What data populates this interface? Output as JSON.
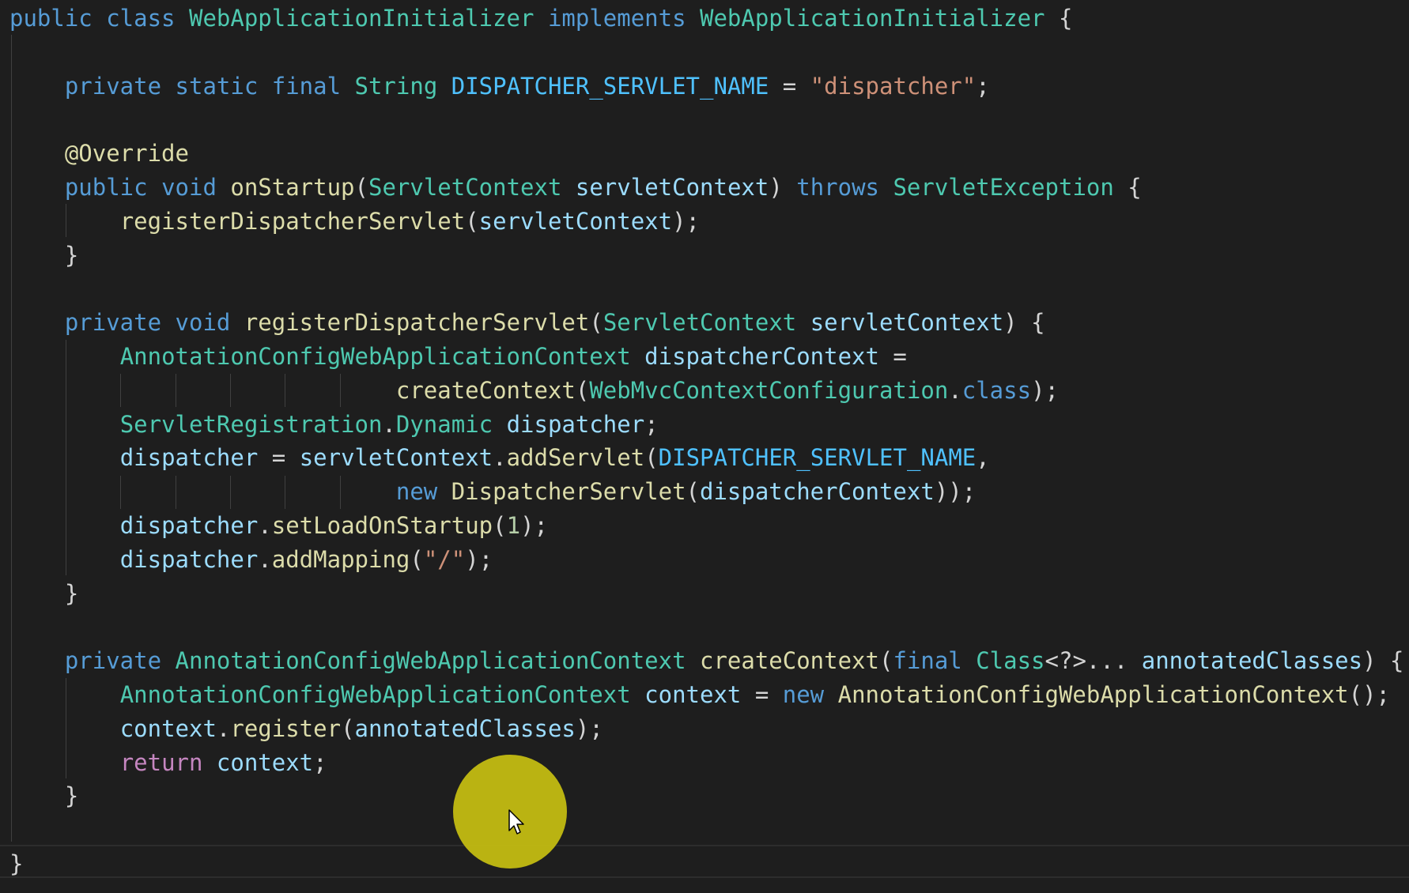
{
  "editor": {
    "language": "java",
    "theme_colors": {
      "background": "#1e1e1e",
      "keyword": "#569cd6",
      "control": "#c586c0",
      "type": "#4ec9b0",
      "function": "#dcdcaa",
      "variable": "#9cdcfe",
      "constant": "#4fc1ff",
      "string": "#ce9178",
      "number": "#b5cea8",
      "text": "#d4d4d4",
      "cursor_highlight": "#c8c011"
    },
    "icons": {
      "mouse_pointer": "mouse-pointer-icon",
      "click_highlight": "cursor-highlight-circle"
    },
    "lines": [
      {
        "tokens": [
          {
            "c": "kw",
            "t": "public "
          },
          {
            "c": "kw",
            "t": "class "
          },
          {
            "c": "type",
            "t": "WebApplicationInitializer "
          },
          {
            "c": "kw",
            "t": "implements "
          },
          {
            "c": "type",
            "t": "WebApplicationInitializer "
          },
          {
            "c": "plain",
            "t": "{"
          }
        ]
      },
      {
        "tokens": []
      },
      {
        "tokens": [
          {
            "c": "plain",
            "t": "    "
          },
          {
            "c": "kw",
            "t": "private "
          },
          {
            "c": "kw",
            "t": "static "
          },
          {
            "c": "kw",
            "t": "final "
          },
          {
            "c": "type",
            "t": "String "
          },
          {
            "c": "cst",
            "t": "DISPATCHER_SERVLET_NAME"
          },
          {
            "c": "plain",
            "t": " = "
          },
          {
            "c": "str",
            "t": "\"dispatcher\""
          },
          {
            "c": "plain",
            "t": ";"
          }
        ]
      },
      {
        "tokens": []
      },
      {
        "tokens": [
          {
            "c": "plain",
            "t": "    "
          },
          {
            "c": "ann",
            "t": "@Override"
          }
        ]
      },
      {
        "tokens": [
          {
            "c": "plain",
            "t": "    "
          },
          {
            "c": "kw",
            "t": "public "
          },
          {
            "c": "kw",
            "t": "void "
          },
          {
            "c": "fn",
            "t": "onStartup"
          },
          {
            "c": "plain",
            "t": "("
          },
          {
            "c": "type",
            "t": "ServletContext "
          },
          {
            "c": "var",
            "t": "servletContext"
          },
          {
            "c": "plain",
            "t": ") "
          },
          {
            "c": "kw",
            "t": "throws "
          },
          {
            "c": "type",
            "t": "ServletException "
          },
          {
            "c": "plain",
            "t": "{"
          }
        ]
      },
      {
        "tokens": [
          {
            "c": "plain",
            "t": "        "
          },
          {
            "c": "fn",
            "t": "registerDispatcherServlet"
          },
          {
            "c": "plain",
            "t": "("
          },
          {
            "c": "var",
            "t": "servletContext"
          },
          {
            "c": "plain",
            "t": ");"
          }
        ]
      },
      {
        "tokens": [
          {
            "c": "plain",
            "t": "    }"
          }
        ]
      },
      {
        "tokens": []
      },
      {
        "tokens": [
          {
            "c": "plain",
            "t": "    "
          },
          {
            "c": "kw",
            "t": "private "
          },
          {
            "c": "kw",
            "t": "void "
          },
          {
            "c": "fn",
            "t": "registerDispatcherServlet"
          },
          {
            "c": "plain",
            "t": "("
          },
          {
            "c": "type",
            "t": "ServletContext "
          },
          {
            "c": "var",
            "t": "servletContext"
          },
          {
            "c": "plain",
            "t": ") {"
          }
        ]
      },
      {
        "tokens": [
          {
            "c": "plain",
            "t": "        "
          },
          {
            "c": "type",
            "t": "AnnotationConfigWebApplicationContext "
          },
          {
            "c": "var",
            "t": "dispatcherContext"
          },
          {
            "c": "plain",
            "t": " ="
          }
        ]
      },
      {
        "tokens": [
          {
            "c": "plain",
            "t": "                            "
          },
          {
            "c": "fn",
            "t": "createContext"
          },
          {
            "c": "plain",
            "t": "("
          },
          {
            "c": "type",
            "t": "WebMvcContextConfiguration"
          },
          {
            "c": "plain",
            "t": "."
          },
          {
            "c": "kw",
            "t": "class"
          },
          {
            "c": "plain",
            "t": ");"
          }
        ]
      },
      {
        "tokens": [
          {
            "c": "plain",
            "t": "        "
          },
          {
            "c": "type",
            "t": "ServletRegistration"
          },
          {
            "c": "plain",
            "t": "."
          },
          {
            "c": "type",
            "t": "Dynamic "
          },
          {
            "c": "var",
            "t": "dispatcher"
          },
          {
            "c": "plain",
            "t": ";"
          }
        ]
      },
      {
        "tokens": [
          {
            "c": "plain",
            "t": "        "
          },
          {
            "c": "var",
            "t": "dispatcher"
          },
          {
            "c": "plain",
            "t": " = "
          },
          {
            "c": "var",
            "t": "servletContext"
          },
          {
            "c": "plain",
            "t": "."
          },
          {
            "c": "fn",
            "t": "addServlet"
          },
          {
            "c": "plain",
            "t": "("
          },
          {
            "c": "cst",
            "t": "DISPATCHER_SERVLET_NAME"
          },
          {
            "c": "plain",
            "t": ","
          }
        ]
      },
      {
        "tokens": [
          {
            "c": "plain",
            "t": "                            "
          },
          {
            "c": "kw",
            "t": "new "
          },
          {
            "c": "fn",
            "t": "DispatcherServlet"
          },
          {
            "c": "plain",
            "t": "("
          },
          {
            "c": "var",
            "t": "dispatcherContext"
          },
          {
            "c": "plain",
            "t": "));"
          }
        ]
      },
      {
        "tokens": [
          {
            "c": "plain",
            "t": "        "
          },
          {
            "c": "var",
            "t": "dispatcher"
          },
          {
            "c": "plain",
            "t": "."
          },
          {
            "c": "fn",
            "t": "setLoadOnStartup"
          },
          {
            "c": "plain",
            "t": "("
          },
          {
            "c": "num",
            "t": "1"
          },
          {
            "c": "plain",
            "t": ");"
          }
        ]
      },
      {
        "tokens": [
          {
            "c": "plain",
            "t": "        "
          },
          {
            "c": "var",
            "t": "dispatcher"
          },
          {
            "c": "plain",
            "t": "."
          },
          {
            "c": "fn",
            "t": "addMapping"
          },
          {
            "c": "plain",
            "t": "("
          },
          {
            "c": "str",
            "t": "\"/\""
          },
          {
            "c": "plain",
            "t": ");"
          }
        ]
      },
      {
        "tokens": [
          {
            "c": "plain",
            "t": "    }"
          }
        ]
      },
      {
        "tokens": []
      },
      {
        "tokens": [
          {
            "c": "plain",
            "t": "    "
          },
          {
            "c": "kw",
            "t": "private "
          },
          {
            "c": "type",
            "t": "AnnotationConfigWebApplicationContext "
          },
          {
            "c": "fn",
            "t": "createContext"
          },
          {
            "c": "plain",
            "t": "("
          },
          {
            "c": "kw",
            "t": "final "
          },
          {
            "c": "type",
            "t": "Class"
          },
          {
            "c": "plain",
            "t": "<?>... "
          },
          {
            "c": "var",
            "t": "annotatedClasses"
          },
          {
            "c": "plain",
            "t": ") {"
          }
        ]
      },
      {
        "tokens": [
          {
            "c": "plain",
            "t": "        "
          },
          {
            "c": "type",
            "t": "AnnotationConfigWebApplicationContext "
          },
          {
            "c": "var",
            "t": "context"
          },
          {
            "c": "plain",
            "t": " = "
          },
          {
            "c": "kw",
            "t": "new "
          },
          {
            "c": "fn",
            "t": "AnnotationConfigWebApplicationContext"
          },
          {
            "c": "plain",
            "t": "();"
          }
        ]
      },
      {
        "tokens": [
          {
            "c": "plain",
            "t": "        "
          },
          {
            "c": "var",
            "t": "context"
          },
          {
            "c": "plain",
            "t": "."
          },
          {
            "c": "fn",
            "t": "register"
          },
          {
            "c": "plain",
            "t": "("
          },
          {
            "c": "var",
            "t": "annotatedClasses"
          },
          {
            "c": "plain",
            "t": ");"
          }
        ]
      },
      {
        "tokens": [
          {
            "c": "plain",
            "t": "        "
          },
          {
            "c": "ctl",
            "t": "return "
          },
          {
            "c": "var",
            "t": "context"
          },
          {
            "c": "plain",
            "t": ";"
          }
        ]
      },
      {
        "tokens": [
          {
            "c": "plain",
            "t": "    }"
          }
        ]
      },
      {
        "tokens": []
      },
      {
        "tokens": [
          {
            "c": "plain",
            "t": "}"
          }
        ]
      }
    ]
  }
}
